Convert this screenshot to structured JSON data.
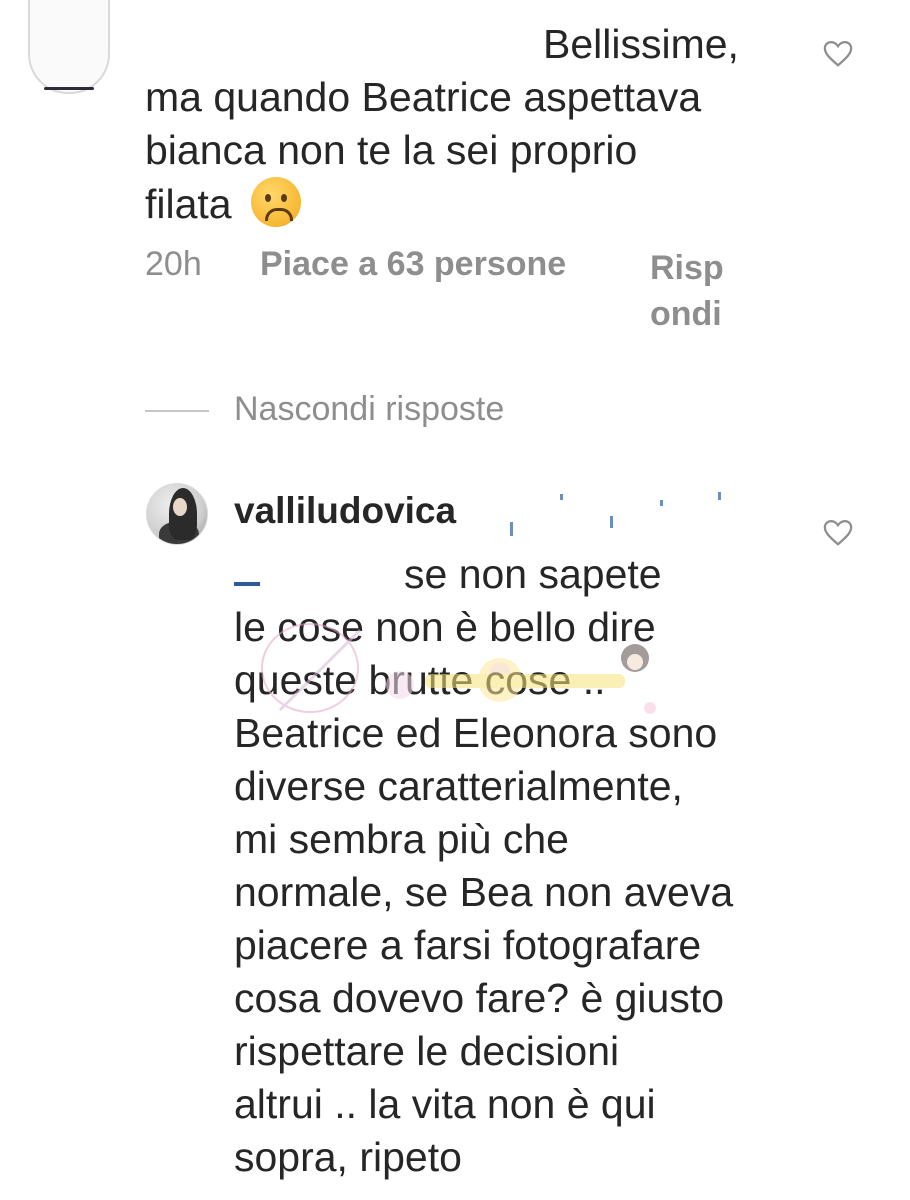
{
  "comment1": {
    "lines": [
      "Bellissime,",
      "ma quando Beatrice aspettava",
      "bianca non te la sei proprio",
      "filata"
    ],
    "emoji": "worried-face-emoji",
    "time": "20h",
    "likes": "Piace a 63 persone",
    "reply": "Risp ondi"
  },
  "replies_toggle": "Nascondi risposte",
  "comment2": {
    "username": "valliludovica",
    "lines": [
      "se non sapete",
      "le cose non è bello dire",
      "queste brutte cose ..",
      "Beatrice ed Eleonora sono",
      "diverse caratterialmente,",
      "mi sembra più che",
      "normale, se Bea non aveva",
      "piacere a farsi fotografare",
      "cosa dovevo fare? è giusto",
      "rispettare le decisioni",
      "altrui .. la vita non è qui",
      "sopra, ripeto"
    ]
  },
  "icons": {
    "like": "heart-outline-icon",
    "avatar": "user-avatar"
  },
  "colors": {
    "text": "#262626",
    "muted": "#8e8e8e",
    "divider": "#c7c7c7"
  }
}
